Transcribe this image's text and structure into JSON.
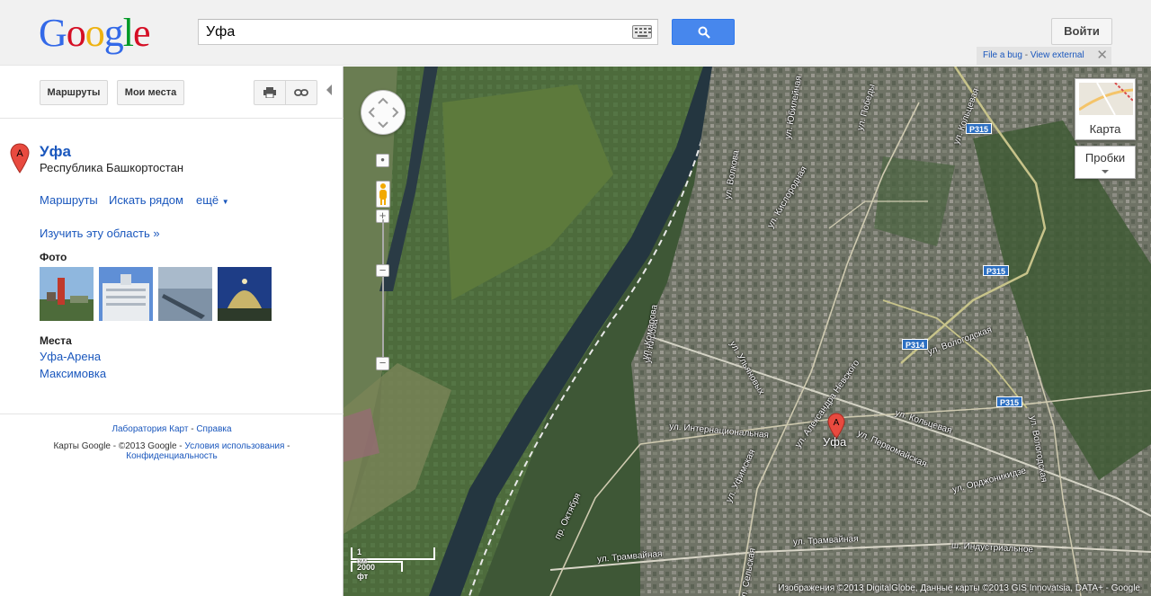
{
  "header": {
    "logo_text": "Google",
    "search_value": "Уфа",
    "signin_label": "Войти",
    "bug_link": "File a bug",
    "bug_sep": " - ",
    "bug_view": "View external"
  },
  "panel": {
    "routes_button": "Маршруты",
    "myplaces_button": "Мои места",
    "place": {
      "marker_letter": "A",
      "title": "Уфа",
      "subtitle": "Республика Башкортостан"
    },
    "actions": [
      "Маршруты",
      "Искать рядом",
      "ещё"
    ],
    "explore_link": "Изучить эту область »",
    "photos_label": "Фото",
    "places_label": "Места",
    "places": [
      "Уфа-Арена",
      "Максимовка"
    ],
    "footer": {
      "lab": "Лаборатория Карт",
      "sep1": " - ",
      "help": "Справка",
      "copyright": "Карты Google - ©2013 Google - ",
      "terms": "Условия использования",
      "sep2": " - ",
      "privacy": "Конфиденциальность"
    }
  },
  "map": {
    "maptype_label": "Карта",
    "traffic_label": "Пробки",
    "marker_letter": "A",
    "city_label": "Уфа",
    "scale_km": "1 км",
    "scale_ft": "2000 фт",
    "attribution": "Изображения ©2013 DigitalGlobe, Данные карты ©2013 GIS Innovatsia, DATA+ - Google",
    "shields": [
      "P315",
      "P315",
      "P314",
      "P315"
    ],
    "roads": [
      "ул. Юбилейная",
      "ул. Победы",
      "ул. Кольцевая",
      "ул. Вологодская",
      "ул. Интернациональная",
      "ул. Первомайская",
      "ул. Кольцевая",
      "ул. Орджоникидзе",
      "ул. Трамвайная",
      "ш. Индустриальное",
      "ул. Александра Невского",
      "ул. Ульяновых",
      "ул. Уфимская",
      "ул. Кирова",
      "ул. Вологодская",
      "пр. Октября",
      "ул. Трамвайная",
      "ул. Кислородная",
      "ул. Волкова",
      "ул. Комарова",
      "ул. Сельская"
    ]
  },
  "colors": {
    "link": "#1a57bd",
    "search_button": "#4787ed",
    "marker": "#e84a3f",
    "shield": "#2c6fc2"
  }
}
